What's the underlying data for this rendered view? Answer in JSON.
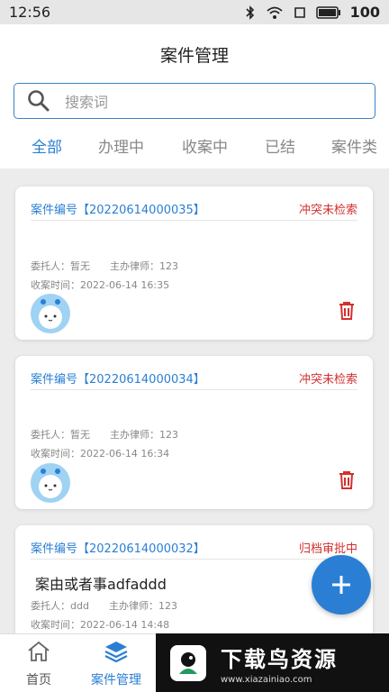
{
  "status_bar": {
    "time": "12:56",
    "battery": "100"
  },
  "header": {
    "title": "案件管理"
  },
  "search": {
    "placeholder": "搜索词"
  },
  "tabs": [
    {
      "label": "全部",
      "active": true
    },
    {
      "label": "办理中"
    },
    {
      "label": "收案中"
    },
    {
      "label": "已结"
    },
    {
      "label": "案件类"
    }
  ],
  "cards": [
    {
      "case_no": "案件编号【20220614000035】",
      "status": "冲突未检索",
      "client": "委托人：暂无",
      "lawyer": "主办律师：123",
      "time": "收案时间：2022-06-14 16:35"
    },
    {
      "case_no": "案件编号【20220614000034】",
      "status": "冲突未检索",
      "client": "委托人：暂无",
      "lawyer": "主办律师：123",
      "time": "收案时间：2022-06-14 16:34"
    },
    {
      "case_no": "案件编号【20220614000032】",
      "status": "归档审批中",
      "cause": "案由或者事adfaddd",
      "client": "委托人：ddd",
      "lawyer": "主办律师：123",
      "time": "收案时间：2022-06-14 14:48"
    }
  ],
  "bottom_nav": [
    {
      "label": "首页",
      "icon": "home-icon"
    },
    {
      "label": "案件管理",
      "icon": "layers-icon",
      "active": true
    }
  ],
  "watermark": {
    "title": "下载鸟资源",
    "url": "www.xiazainiao.com"
  },
  "colors": {
    "accent": "#2a7fd4",
    "status_red": "#d32f2f"
  }
}
